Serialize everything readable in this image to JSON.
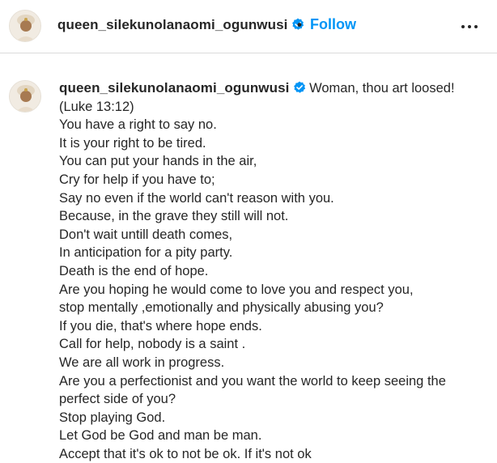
{
  "header": {
    "username": "queen_silekunolanaomi_ogunwusi",
    "separator": "•",
    "follow_label": "Follow",
    "more_icon": "more-horizontal-icon",
    "verified_icon": "verified-badge-icon"
  },
  "caption": {
    "username": "queen_silekunolanaomi_ogunwusi",
    "first_line_text": " Woman, thou art loosed!",
    "lines": [
      "(Luke 13:12)",
      "You have a right to say no.",
      "It is your right to be tired.",
      "You can put your hands in the air,",
      "Cry for help if you have to;",
      "Say no even if the world can't reason with you.",
      "Because, in the grave they still will not.",
      "Don't wait untill death comes,",
      "In anticipation for a pity party.",
      "Death is the end of hope.",
      "Are you hoping he would come to love you and respect you,",
      "stop mentally ,emotionally and physically abusing you?",
      "If you die, that's where hope ends.",
      "Call for help, nobody is a saint .",
      "We are all work in progress.",
      "Are you a perfectionist and you want the world to keep seeing the",
      "perfect side of you?",
      "Stop playing God.",
      "Let God be God and man be man.",
      "Accept that it's ok to not be ok. If it's not ok"
    ]
  },
  "colors": {
    "accent": "#0095f6",
    "text": "#262626",
    "divider": "#dbdbdb"
  }
}
